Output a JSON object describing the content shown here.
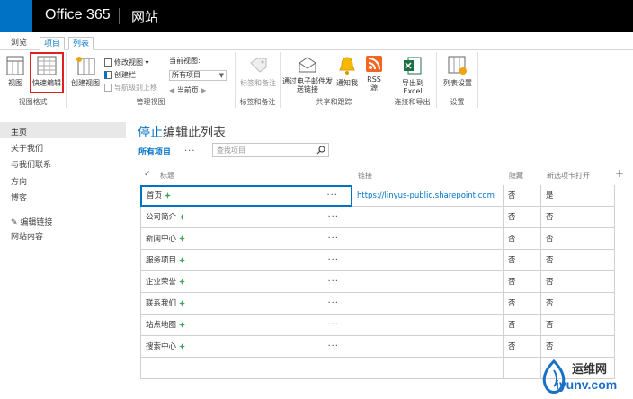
{
  "suite": {
    "brand": "Office 365",
    "title": "网站"
  },
  "tabs": [
    {
      "label": "浏览"
    },
    {
      "label": "项目"
    },
    {
      "label": "列表"
    }
  ],
  "ribbon": {
    "groups": [
      {
        "label": "视图格式",
        "buttons": [
          "视图",
          "快速编辑"
        ]
      },
      {
        "label": "管理视图",
        "create_view": "创建视图",
        "modify_view": "修改视图",
        "create_column": "创建栏",
        "nav_up": "导航级别上移",
        "current_view_label": "当前视图:",
        "current_view_value": "所有项目",
        "current_page": "当前页"
      },
      {
        "label": "标签和备注",
        "button": "标签和备注"
      },
      {
        "label": "共享和跟踪",
        "email": "通过电子邮件发送链接",
        "alert": "通知我",
        "rss": "RSS 源"
      },
      {
        "label": "连接和导出",
        "export": "导出到 Excel"
      },
      {
        "label": "设置",
        "list_settings": "列表设置"
      }
    ]
  },
  "leftnav": {
    "items": [
      "主页",
      "关于我们",
      "与我们联系",
      "方向",
      "博客"
    ],
    "edit_links": "编辑链接",
    "site_contents": "网站内容"
  },
  "main": {
    "title_link": "停止",
    "title_rest": "编辑此列表",
    "view_tab": "所有项目",
    "view_more": "...",
    "search_placeholder": "查找项目",
    "columns": [
      "标题",
      "链接",
      "隐藏",
      "新选项卡打开"
    ],
    "rows": [
      {
        "title": "首页",
        "link": "https://linyus-public.sharepoint.com",
        "hidden": "否",
        "new_tab": "是"
      },
      {
        "title": "公司简介",
        "link": "",
        "hidden": "否",
        "new_tab": "否"
      },
      {
        "title": "新闻中心",
        "link": "",
        "hidden": "否",
        "new_tab": "否"
      },
      {
        "title": "服务项目",
        "link": "",
        "hidden": "否",
        "new_tab": "否"
      },
      {
        "title": "企业荣誉",
        "link": "",
        "hidden": "否",
        "new_tab": "否"
      },
      {
        "title": "联系我们",
        "link": "",
        "hidden": "否",
        "new_tab": "否"
      },
      {
        "title": "站点地图",
        "link": "",
        "hidden": "否",
        "new_tab": "否"
      },
      {
        "title": "搜索中心",
        "link": "",
        "hidden": "否",
        "new_tab": "否"
      },
      {
        "title": "",
        "link": "",
        "hidden": "",
        "new_tab": ""
      }
    ],
    "dots": "···"
  },
  "watermark": {
    "line1": "运维网",
    "line2": "iyunv.com"
  },
  "colors": {
    "accent": "#0072c6",
    "suite_bg": "#000000",
    "highlight": "#e02020",
    "new_icon": "#3aa757"
  }
}
